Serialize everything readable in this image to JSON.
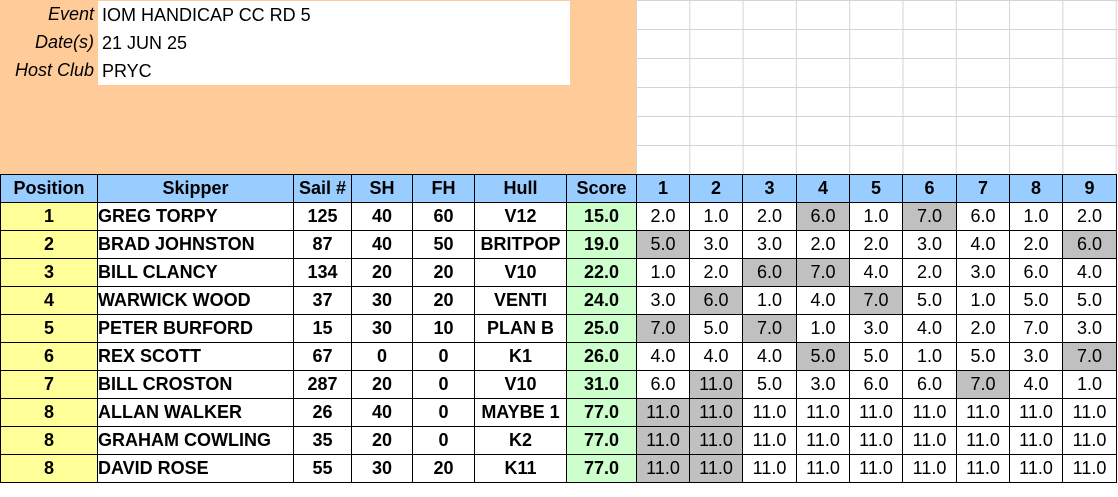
{
  "event": {
    "label": "Event",
    "value": "IOM HANDICAP CC RD 5"
  },
  "dates": {
    "label": "Date(s)",
    "value": "21 JUN 25"
  },
  "host_club": {
    "label": "Host Club",
    "value": "PRYC"
  },
  "colors": {
    "header_panel": "#FFCC99",
    "column_header": "#99CCFF",
    "position": "#FFFF99",
    "score": "#CCFFCC",
    "discarded": "#C0C0C0"
  },
  "table": {
    "headers": [
      "Position",
      "Skipper",
      "Sail #",
      "SH",
      "FH",
      "Hull",
      "Score",
      "1",
      "2",
      "3",
      "4",
      "5",
      "6",
      "7",
      "8",
      "9"
    ],
    "rows": [
      {
        "position": "1",
        "skipper": "GREG TORPY",
        "sail": "125",
        "sh": "40",
        "fh": "60",
        "hull": "V12",
        "score": "15.0",
        "races": [
          "2.0",
          "1.0",
          "2.0",
          "6.0",
          "1.0",
          "7.0",
          "6.0",
          "1.0",
          "2.0"
        ],
        "dropped": [
          3,
          5
        ]
      },
      {
        "position": "2",
        "skipper": "BRAD JOHNSTON",
        "sail": "87",
        "sh": "40",
        "fh": "50",
        "hull": "BRITPOP",
        "score": "19.0",
        "races": [
          "5.0",
          "3.0",
          "3.0",
          "2.0",
          "2.0",
          "3.0",
          "4.0",
          "2.0",
          "6.0"
        ],
        "dropped": [
          0,
          8
        ]
      },
      {
        "position": "3",
        "skipper": "BILL CLANCY",
        "sail": "134",
        "sh": "20",
        "fh": "20",
        "hull": "V10",
        "score": "22.0",
        "races": [
          "1.0",
          "2.0",
          "6.0",
          "7.0",
          "4.0",
          "2.0",
          "3.0",
          "6.0",
          "4.0"
        ],
        "dropped": [
          2,
          3
        ]
      },
      {
        "position": "4",
        "skipper": "WARWICK WOOD",
        "sail": "37",
        "sh": "30",
        "fh": "20",
        "hull": "VENTI",
        "score": "24.0",
        "races": [
          "3.0",
          "6.0",
          "1.0",
          "4.0",
          "7.0",
          "5.0",
          "1.0",
          "5.0",
          "5.0"
        ],
        "dropped": [
          1,
          4
        ]
      },
      {
        "position": "5",
        "skipper": "PETER BURFORD",
        "sail": "15",
        "sh": "30",
        "fh": "10",
        "hull": "PLAN B",
        "score": "25.0",
        "races": [
          "7.0",
          "5.0",
          "7.0",
          "1.0",
          "3.0",
          "4.0",
          "2.0",
          "7.0",
          "3.0"
        ],
        "dropped": [
          0,
          2
        ]
      },
      {
        "position": "6",
        "skipper": "REX SCOTT",
        "sail": "67",
        "sh": "0",
        "fh": "0",
        "hull": "K1",
        "score": "26.0",
        "races": [
          "4.0",
          "4.0",
          "4.0",
          "5.0",
          "5.0",
          "1.0",
          "5.0",
          "3.0",
          "7.0"
        ],
        "dropped": [
          3,
          8
        ]
      },
      {
        "position": "7",
        "skipper": "BILL CROSTON",
        "sail": "287",
        "sh": "20",
        "fh": "0",
        "hull": "V10",
        "score": "31.0",
        "races": [
          "6.0",
          "11.0",
          "5.0",
          "3.0",
          "6.0",
          "6.0",
          "7.0",
          "4.0",
          "1.0"
        ],
        "dropped": [
          1,
          6
        ]
      },
      {
        "position": "8",
        "skipper": "ALLAN WALKER",
        "sail": "26",
        "sh": "40",
        "fh": "0",
        "hull": "MAYBE 1",
        "score": "77.0",
        "races": [
          "11.0",
          "11.0",
          "11.0",
          "11.0",
          "11.0",
          "11.0",
          "11.0",
          "11.0",
          "11.0"
        ],
        "dropped": [
          0,
          1
        ]
      },
      {
        "position": "8",
        "skipper": "GRAHAM COWLING",
        "sail": "35",
        "sh": "20",
        "fh": "0",
        "hull": "K2",
        "score": "77.0",
        "races": [
          "11.0",
          "11.0",
          "11.0",
          "11.0",
          "11.0",
          "11.0",
          "11.0",
          "11.0",
          "11.0"
        ],
        "dropped": [
          0,
          1
        ]
      },
      {
        "position": "8",
        "skipper": "DAVID ROSE",
        "sail": "55",
        "sh": "30",
        "fh": "20",
        "hull": "K11",
        "score": "77.0",
        "races": [
          "11.0",
          "11.0",
          "11.0",
          "11.0",
          "11.0",
          "11.0",
          "11.0",
          "11.0",
          "11.0"
        ],
        "dropped": [
          0,
          1
        ]
      }
    ]
  }
}
